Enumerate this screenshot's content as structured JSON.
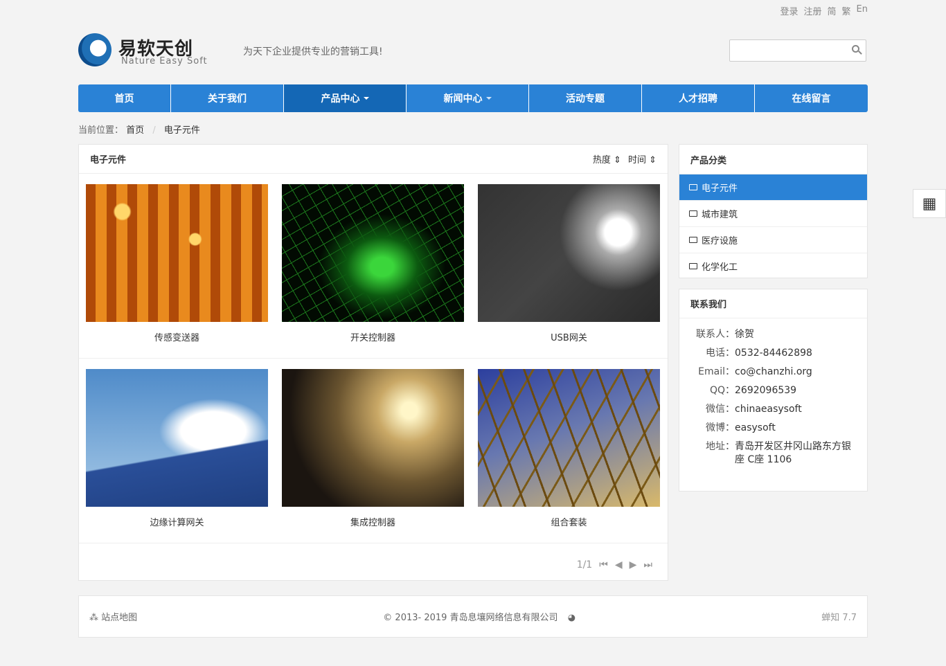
{
  "top_links": [
    "登录",
    "注册",
    "简",
    "繁",
    "En"
  ],
  "logo": {
    "cn": "易软天创",
    "en": "Nature Easy Soft"
  },
  "slogan": "为天下企业提供专业的营销工具!",
  "search": {
    "placeholder": ""
  },
  "nav": [
    {
      "label": "首页"
    },
    {
      "label": "关于我们"
    },
    {
      "label": "产品中心",
      "active": true,
      "dropdown": true
    },
    {
      "label": "新闻中心",
      "dropdown": true
    },
    {
      "label": "活动专题"
    },
    {
      "label": "人才招聘"
    },
    {
      "label": "在线留言"
    }
  ],
  "breadcrumb": {
    "prefix": "当前位置：",
    "home": "首页",
    "current": "电子元件"
  },
  "main": {
    "title": "电子元件",
    "sort": [
      "热度",
      "时间"
    ],
    "products": [
      {
        "name": "传感变送器"
      },
      {
        "name": "开关控制器"
      },
      {
        "name": "USB网关"
      },
      {
        "name": "边缘计算网关"
      },
      {
        "name": "集成控制器"
      },
      {
        "name": "组合套装"
      }
    ],
    "pager": "1/1"
  },
  "categories": {
    "title": "产品分类",
    "items": [
      "电子元件",
      "城市建筑",
      "医疗设施",
      "化学化工"
    ]
  },
  "contact": {
    "title": "联系我们",
    "items": [
      [
        "联系人：",
        "徐贺"
      ],
      [
        "电话：",
        "0532-84462898"
      ],
      [
        "Email：",
        "co@chanzhi.org"
      ],
      [
        "QQ：",
        "2692096539"
      ],
      [
        "微信：",
        "chinaeasysoft"
      ],
      [
        "微博：",
        "easysoft"
      ],
      [
        "地址：",
        "青岛开发区井冈山路东方银座 C座 1106"
      ]
    ]
  },
  "footer": {
    "sitemap": "站点地图",
    "copyright": "© 2013- 2019 青岛息壤网络信息有限公司",
    "powered": "蝉知 7.7"
  },
  "colors": {
    "accent": "#2a82d6",
    "accent_dark": "#1467b5"
  }
}
